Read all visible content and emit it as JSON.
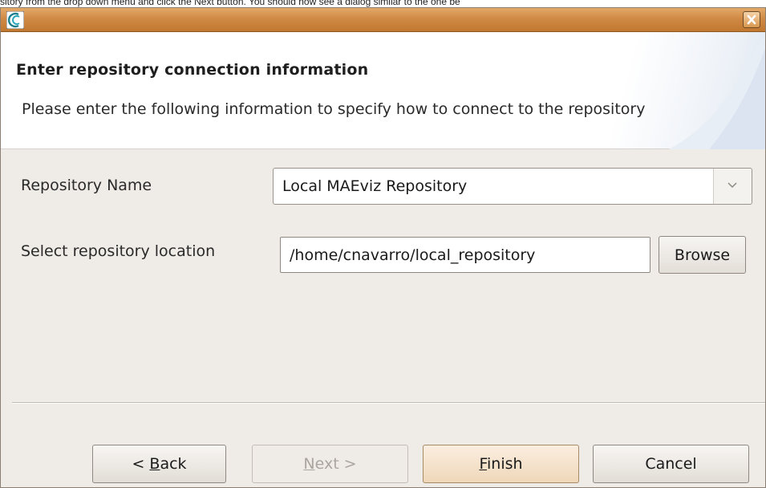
{
  "caption": "sitory from the drop down menu and click the Next button. You should now see a dialog similar to the one be",
  "titlebar": {
    "app_icon": "application-logo-icon",
    "close_icon": "close-x-icon"
  },
  "header": {
    "title": "Enter repository connection information",
    "description": "Please enter the following information to specify how to connect to the repository"
  },
  "form": {
    "repository_name_label": "Repository Name",
    "repository_name_value": "Local MAEviz Repository",
    "repository_location_label": "Select repository location",
    "repository_location_value": "/home/cnavarro/local_repository",
    "browse_label": "Browse"
  },
  "buttons": {
    "back": {
      "prefix": "< ",
      "mnemonic": "B",
      "rest": "ack"
    },
    "next": {
      "mnemonic": "N",
      "rest": "ext >"
    },
    "finish": {
      "mnemonic": "F",
      "rest": "inish"
    },
    "cancel": "Cancel"
  },
  "colors": {
    "titlebar": "#d08a45",
    "window_bg": "#efebe7",
    "default_button": "#efd7b9"
  }
}
